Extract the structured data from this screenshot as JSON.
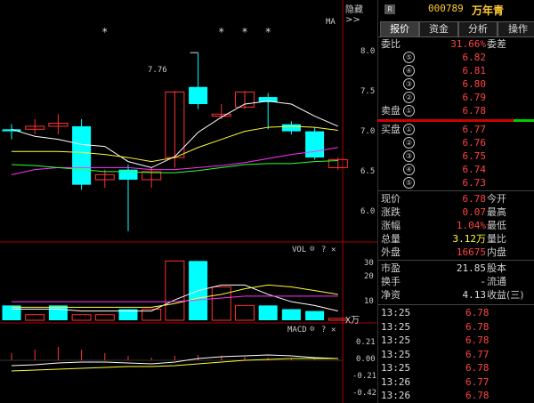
{
  "toolbar": {
    "hide_label": "隐藏>>"
  },
  "chart": {
    "ma_label": "MA",
    "price_ticks": [
      "8.0",
      "7.5",
      "7.0",
      "6.5",
      "6.0"
    ],
    "high_marker": "7.76",
    "vol_label": "VOL",
    "vol_ticks": [
      "30",
      "20",
      "10"
    ],
    "vol_unit": "X万",
    "macd_label": "MACD",
    "macd_ticks": [
      "0.21",
      "0.00",
      "-0.21",
      "-0.42"
    ],
    "star": "*"
  },
  "chart_data": {
    "type": "candlestick",
    "candles": [
      {
        "open": 6.98,
        "close": 7.0,
        "high": 7.05,
        "low": 6.9,
        "color": "cyan"
      },
      {
        "open": 7.0,
        "close": 7.03,
        "high": 7.1,
        "low": 6.95,
        "color": "red"
      },
      {
        "open": 7.03,
        "close": 7.06,
        "high": 7.15,
        "low": 6.95,
        "color": "red"
      },
      {
        "open": 7.03,
        "close": 6.45,
        "high": 7.1,
        "low": 6.4,
        "color": "cyan"
      },
      {
        "open": 6.5,
        "close": 6.55,
        "high": 6.6,
        "low": 6.42,
        "color": "red"
      },
      {
        "open": 6.6,
        "close": 6.5,
        "high": 6.65,
        "low": 5.99,
        "color": "cyan"
      },
      {
        "open": 6.5,
        "close": 6.58,
        "high": 6.62,
        "low": 6.42,
        "color": "red"
      },
      {
        "open": 6.72,
        "close": 7.37,
        "high": 7.38,
        "low": 6.62,
        "color": "red"
      },
      {
        "open": 7.42,
        "close": 7.25,
        "high": 7.76,
        "low": 7.2,
        "color": "cyan"
      },
      {
        "open": 7.13,
        "close": 7.15,
        "high": 7.25,
        "low": 7.1,
        "color": "red"
      },
      {
        "open": 7.22,
        "close": 7.37,
        "high": 7.38,
        "low": 7.2,
        "color": "red"
      },
      {
        "open": 7.32,
        "close": 7.27,
        "high": 7.36,
        "low": 7.0,
        "color": "cyan"
      },
      {
        "open": 7.05,
        "close": 6.98,
        "high": 7.08,
        "low": 6.95,
        "color": "cyan"
      },
      {
        "open": 6.98,
        "close": 6.72,
        "high": 7.02,
        "low": 6.7,
        "color": "cyan"
      },
      {
        "open": 6.62,
        "close": 6.7,
        "high": 6.72,
        "low": 6.6,
        "color": "red"
      }
    ],
    "volume": [
      {
        "v": 8,
        "color": "cyan"
      },
      {
        "v": 3,
        "color": "red"
      },
      {
        "v": 8,
        "color": "cyan"
      },
      {
        "v": 3,
        "color": "red"
      },
      {
        "v": 3,
        "color": "red"
      },
      {
        "v": 6,
        "color": "cyan"
      },
      {
        "v": 6,
        "color": "red"
      },
      {
        "v": 32,
        "color": "red"
      },
      {
        "v": 32,
        "color": "cyan"
      },
      {
        "v": 18,
        "color": "red"
      },
      {
        "v": 8,
        "color": "red"
      },
      {
        "v": 8,
        "color": "cyan"
      },
      {
        "v": 6,
        "color": "cyan"
      },
      {
        "v": 5,
        "color": "cyan"
      },
      {
        "v": 1,
        "color": "red"
      }
    ],
    "ma_series": [
      {
        "color": "#ffffff",
        "values": [
          7.0,
          6.93,
          6.9,
          6.85,
          6.83,
          6.68,
          6.62,
          6.73,
          6.97,
          7.12,
          7.25,
          7.28,
          7.25,
          7.13,
          7.03
        ]
      },
      {
        "color": "#ffff33",
        "values": [
          6.78,
          6.78,
          6.78,
          6.77,
          6.75,
          6.72,
          6.68,
          6.72,
          6.82,
          6.9,
          6.98,
          7.02,
          7.03,
          7.02,
          6.99
        ]
      },
      {
        "color": "#ff33ff",
        "values": [
          6.55,
          6.6,
          6.62,
          6.62,
          6.62,
          6.62,
          6.6,
          6.6,
          6.62,
          6.64,
          6.67,
          6.71,
          6.75,
          6.78,
          6.82
        ]
      },
      {
        "color": "#33ff33",
        "values": [
          6.65,
          6.64,
          6.62,
          6.6,
          6.58,
          6.58,
          6.57,
          6.57,
          6.59,
          6.62,
          6.65,
          6.66,
          6.66,
          6.68,
          6.69
        ]
      }
    ],
    "vol_ma_series": [
      {
        "color": "#ffffff",
        "values": [
          6,
          6,
          6,
          5,
          5,
          5,
          5,
          11,
          16,
          19,
          19,
          14,
          10,
          8,
          5
        ]
      },
      {
        "color": "#ffff33",
        "values": [
          7,
          7,
          7,
          7,
          7,
          7,
          7,
          9,
          12,
          14,
          17,
          19,
          18,
          16,
          14
        ]
      },
      {
        "color": "#ff33ff",
        "values": [
          10,
          10,
          10,
          10,
          10,
          10,
          10,
          10,
          11,
          12,
          13,
          13,
          13,
          13,
          13
        ]
      }
    ],
    "macd_hist": [
      {
        "v": 0.08,
        "color": "red"
      },
      {
        "v": 0.12,
        "color": "red"
      },
      {
        "v": 0.15,
        "color": "red"
      },
      {
        "v": 0.12,
        "color": "red"
      },
      {
        "v": 0.08,
        "color": "red"
      },
      {
        "v": 0.05,
        "color": "red"
      },
      {
        "v": 0.03,
        "color": "red"
      },
      {
        "v": 0.05,
        "color": "red"
      },
      {
        "v": 0.06,
        "color": "red"
      },
      {
        "v": 0.05,
        "color": "red"
      },
      {
        "v": 0.04,
        "color": "red"
      },
      {
        "v": 0.03,
        "color": "red"
      },
      {
        "v": 0.02,
        "color": "red"
      },
      {
        "v": 0.01,
        "color": "red"
      },
      {
        "v": 0.01,
        "color": "red"
      }
    ],
    "macd_lines": [
      {
        "color": "#ffffff",
        "values": [
          -0.06,
          -0.05,
          -0.03,
          -0.02,
          -0.02,
          -0.03,
          -0.04,
          -0.02,
          0.02,
          0.04,
          0.05,
          0.06,
          0.05,
          0.03,
          0.02
        ]
      },
      {
        "color": "#ffff33",
        "values": [
          -0.12,
          -0.11,
          -0.1,
          -0.09,
          -0.08,
          -0.07,
          -0.07,
          -0.06,
          -0.04,
          -0.02,
          0.0,
          0.01,
          0.02,
          0.02,
          0.02
        ]
      }
    ],
    "stars_at": [
      4,
      9,
      10,
      11
    ],
    "price_range": [
      5.9,
      8.15
    ],
    "vol_range": [
      0,
      36
    ],
    "macd_range": [
      -0.45,
      0.3
    ]
  },
  "side": {
    "badge": "R",
    "code": "000789",
    "name": "万年青",
    "tabs": [
      "报价",
      "资金",
      "分析",
      "操作"
    ],
    "weibi": {
      "label": "委比",
      "value": "31.66%",
      "label2": "委差"
    },
    "sell_label": "卖盘",
    "sell": [
      {
        "n": "⑤",
        "price": "6.82"
      },
      {
        "n": "④",
        "price": "6.81"
      },
      {
        "n": "③",
        "price": "6.80"
      },
      {
        "n": "②",
        "price": "6.79"
      },
      {
        "n": "①",
        "price": "6.78"
      }
    ],
    "buy_label": "买盘",
    "buy": [
      {
        "n": "①",
        "price": "6.77"
      },
      {
        "n": "②",
        "price": "6.76"
      },
      {
        "n": "③",
        "price": "6.75"
      },
      {
        "n": "④",
        "price": "6.74"
      },
      {
        "n": "⑤",
        "price": "6.73"
      }
    ],
    "quotes": [
      {
        "k": "现价",
        "v": "6.78",
        "k2": "今开"
      },
      {
        "k": "涨跌",
        "v": "0.07",
        "k2": "最高"
      },
      {
        "k": "涨幅",
        "v": "1.04%",
        "k2": "最低"
      },
      {
        "k": "总量",
        "v": "3.12万",
        "k2": "量比"
      },
      {
        "k": "外盘",
        "v": "16675",
        "k2": "内盘"
      }
    ],
    "finance": [
      {
        "k": "市盈",
        "v": "21.85",
        "k2": "股本"
      },
      {
        "k": "换手",
        "v": "-",
        "k2": "流通"
      },
      {
        "k": "净资",
        "v": "4.13",
        "k2": "收益(三)"
      }
    ],
    "ticks": [
      {
        "t": "13:25",
        "p": "6.78"
      },
      {
        "t": "13:25",
        "p": "6.78"
      },
      {
        "t": "13:25",
        "p": "6.78"
      },
      {
        "t": "13:25",
        "p": "6.77"
      },
      {
        "t": "13:25",
        "p": "6.78"
      },
      {
        "t": "13:26",
        "p": "6.77"
      },
      {
        "t": "13:26",
        "p": "6.78"
      }
    ]
  }
}
